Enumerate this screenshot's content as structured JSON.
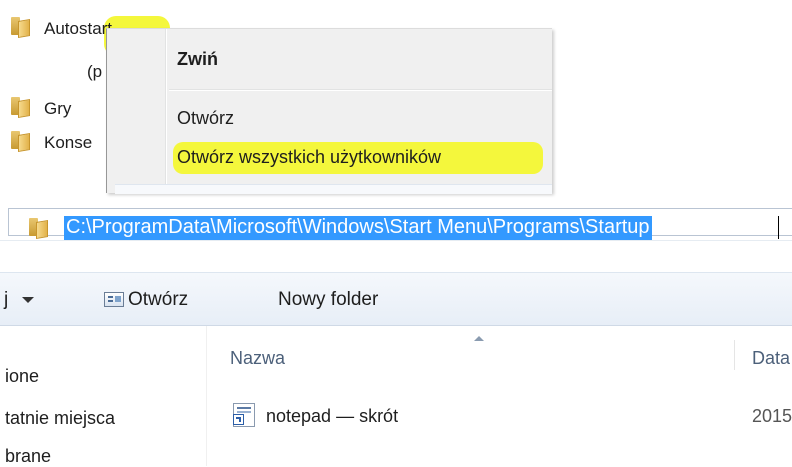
{
  "tree": {
    "items": [
      {
        "label": "Autostart"
      },
      {
        "label": "(p"
      },
      {
        "label": "Gry"
      },
      {
        "label": "Konse"
      }
    ]
  },
  "context_menu": {
    "items": [
      {
        "label": "Zwiń"
      },
      {
        "label": "Otwórz"
      },
      {
        "label": "Otwórz wszystkich użytkowników"
      }
    ]
  },
  "address_bar": {
    "path": "C:\\ProgramData\\Microsoft\\Windows\\Start Menu\\Programs\\Startup"
  },
  "toolbar": {
    "organize_partial": "j",
    "open_label": "Otwórz",
    "new_folder_label": "Nowy folder"
  },
  "navigation": {
    "items": [
      {
        "label": "ione"
      },
      {
        "label": "tatnie miejsca"
      },
      {
        "label": "brane"
      }
    ]
  },
  "columns": {
    "name": "Nazwa",
    "date": "Data"
  },
  "files": [
    {
      "name": "notepad — skrót",
      "date": "2015"
    }
  ],
  "colors": {
    "highlight": "#f4f73c",
    "selection": "#3399ff"
  }
}
